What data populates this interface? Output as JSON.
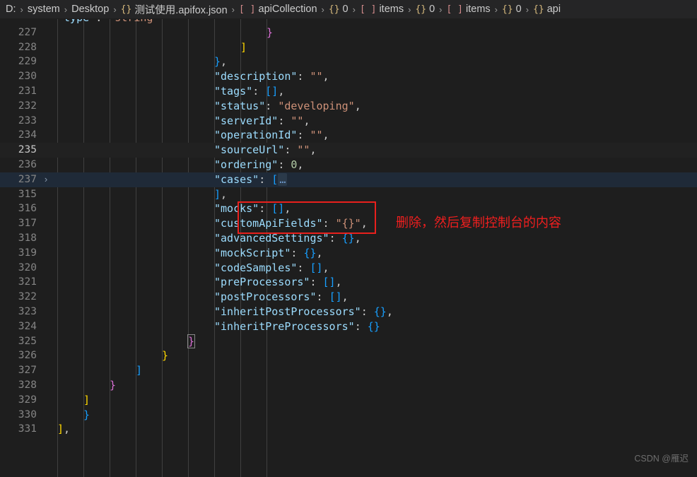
{
  "breadcrumb": {
    "name": "file-path-breadcrumb",
    "separator": "›",
    "items": [
      {
        "label": "D:",
        "symbol": "",
        "symbol_kind": "none"
      },
      {
        "label": "system",
        "symbol": "",
        "symbol_kind": "none"
      },
      {
        "label": "Desktop",
        "symbol": "",
        "symbol_kind": "none"
      },
      {
        "label": "测试使用.apifox.json",
        "symbol": "{}",
        "symbol_kind": "object"
      },
      {
        "label": "apiCollection",
        "symbol": "[ ]",
        "symbol_kind": "array"
      },
      {
        "label": "0",
        "symbol": "{}",
        "symbol_kind": "object"
      },
      {
        "label": "items",
        "symbol": "[ ]",
        "symbol_kind": "array"
      },
      {
        "label": "0",
        "symbol": "{}",
        "symbol_kind": "object"
      },
      {
        "label": "items",
        "symbol": "[ ]",
        "symbol_kind": "array"
      },
      {
        "label": "0",
        "symbol": "{}",
        "symbol_kind": "object"
      },
      {
        "label": "api",
        "symbol": "{}",
        "symbol_kind": "object"
      }
    ]
  },
  "editor": {
    "language": "json",
    "current_line": 235,
    "selected_line": 237,
    "folded_at_line": 237,
    "fold_chevron": "›",
    "lines": [
      {
        "num": "",
        "indent": 0,
        "state": "clipped-top",
        "tokens": [
          {
            "t": "\"type\"",
            "c": "k"
          },
          {
            "t": ": ",
            "c": "p"
          },
          {
            "t": "\"string\"",
            "c": "s"
          }
        ]
      },
      {
        "num": "227",
        "indent": 8,
        "state": "normal",
        "tokens": [
          {
            "t": "}",
            "c": "b2"
          }
        ]
      },
      {
        "num": "228",
        "indent": 7,
        "state": "normal",
        "tokens": [
          {
            "t": "]",
            "c": "b1"
          }
        ]
      },
      {
        "num": "229",
        "indent": 6,
        "state": "normal",
        "tokens": [
          {
            "t": "}",
            "c": "b3"
          },
          {
            "t": ",",
            "c": "p"
          }
        ]
      },
      {
        "num": "230",
        "indent": 6,
        "state": "normal",
        "tokens": [
          {
            "t": "\"description\"",
            "c": "k"
          },
          {
            "t": ": ",
            "c": "p"
          },
          {
            "t": "\"\"",
            "c": "s"
          },
          {
            "t": ",",
            "c": "p"
          }
        ]
      },
      {
        "num": "231",
        "indent": 6,
        "state": "normal",
        "tokens": [
          {
            "t": "\"tags\"",
            "c": "k"
          },
          {
            "t": ": ",
            "c": "p"
          },
          {
            "t": "[]",
            "c": "b3"
          },
          {
            "t": ",",
            "c": "p"
          }
        ]
      },
      {
        "num": "232",
        "indent": 6,
        "state": "normal",
        "tokens": [
          {
            "t": "\"status\"",
            "c": "k"
          },
          {
            "t": ": ",
            "c": "p"
          },
          {
            "t": "\"developing\"",
            "c": "s"
          },
          {
            "t": ",",
            "c": "p"
          }
        ]
      },
      {
        "num": "233",
        "indent": 6,
        "state": "normal",
        "tokens": [
          {
            "t": "\"serverId\"",
            "c": "k"
          },
          {
            "t": ": ",
            "c": "p"
          },
          {
            "t": "\"\"",
            "c": "s"
          },
          {
            "t": ",",
            "c": "p"
          }
        ]
      },
      {
        "num": "234",
        "indent": 6,
        "state": "normal",
        "tokens": [
          {
            "t": "\"operationId\"",
            "c": "k"
          },
          {
            "t": ": ",
            "c": "p"
          },
          {
            "t": "\"\"",
            "c": "s"
          },
          {
            "t": ",",
            "c": "p"
          }
        ]
      },
      {
        "num": "235",
        "indent": 6,
        "state": "current",
        "tokens": [
          {
            "t": "\"sourceUrl\"",
            "c": "k"
          },
          {
            "t": ": ",
            "c": "p"
          },
          {
            "t": "\"\"",
            "c": "s"
          },
          {
            "t": ",",
            "c": "p"
          }
        ]
      },
      {
        "num": "236",
        "indent": 6,
        "state": "normal",
        "tokens": [
          {
            "t": "\"ordering\"",
            "c": "k"
          },
          {
            "t": ": ",
            "c": "p"
          },
          {
            "t": "0",
            "c": "n"
          },
          {
            "t": ",",
            "c": "p"
          }
        ]
      },
      {
        "num": "237",
        "indent": 6,
        "state": "selected",
        "fold": true,
        "tokens": [
          {
            "t": "\"cases\"",
            "c": "k"
          },
          {
            "t": ": ",
            "c": "p"
          },
          {
            "t": "[",
            "c": "b3"
          },
          {
            "t": "…",
            "c": "fd"
          }
        ]
      },
      {
        "num": "315",
        "indent": 6,
        "state": "normal",
        "tokens": [
          {
            "t": "]",
            "c": "b3"
          },
          {
            "t": ",",
            "c": "p"
          }
        ]
      },
      {
        "num": "316",
        "indent": 6,
        "state": "normal",
        "tokens": [
          {
            "t": "\"mocks\"",
            "c": "k"
          },
          {
            "t": ": ",
            "c": "p"
          },
          {
            "t": "[]",
            "c": "b3"
          },
          {
            "t": ",",
            "c": "p"
          }
        ]
      },
      {
        "num": "317",
        "indent": 6,
        "state": "normal",
        "tokens": [
          {
            "t": "\"customApiFields\"",
            "c": "k"
          },
          {
            "t": ": ",
            "c": "p"
          },
          {
            "t": "\"{}\"",
            "c": "s"
          },
          {
            "t": ",",
            "c": "p"
          }
        ]
      },
      {
        "num": "318",
        "indent": 6,
        "state": "normal",
        "tokens": [
          {
            "t": "\"advancedSettings\"",
            "c": "k"
          },
          {
            "t": ": ",
            "c": "p"
          },
          {
            "t": "{}",
            "c": "b3"
          },
          {
            "t": ",",
            "c": "p"
          }
        ]
      },
      {
        "num": "319",
        "indent": 6,
        "state": "normal",
        "tokens": [
          {
            "t": "\"mockScript\"",
            "c": "k"
          },
          {
            "t": ": ",
            "c": "p"
          },
          {
            "t": "{}",
            "c": "b3"
          },
          {
            "t": ",",
            "c": "p"
          }
        ]
      },
      {
        "num": "320",
        "indent": 6,
        "state": "normal",
        "tokens": [
          {
            "t": "\"codeSamples\"",
            "c": "k"
          },
          {
            "t": ": ",
            "c": "p"
          },
          {
            "t": "[]",
            "c": "b3"
          },
          {
            "t": ",",
            "c": "p"
          }
        ]
      },
      {
        "num": "321",
        "indent": 6,
        "state": "normal",
        "tokens": [
          {
            "t": "\"preProcessors\"",
            "c": "k"
          },
          {
            "t": ": ",
            "c": "p"
          },
          {
            "t": "[]",
            "c": "b3"
          },
          {
            "t": ",",
            "c": "p"
          }
        ]
      },
      {
        "num": "322",
        "indent": 6,
        "state": "normal",
        "tokens": [
          {
            "t": "\"postProcessors\"",
            "c": "k"
          },
          {
            "t": ": ",
            "c": "p"
          },
          {
            "t": "[]",
            "c": "b3"
          },
          {
            "t": ",",
            "c": "p"
          }
        ]
      },
      {
        "num": "323",
        "indent": 6,
        "state": "normal",
        "tokens": [
          {
            "t": "\"inheritPostProcessors\"",
            "c": "k"
          },
          {
            "t": ": ",
            "c": "p"
          },
          {
            "t": "{}",
            "c": "b3"
          },
          {
            "t": ",",
            "c": "p"
          }
        ]
      },
      {
        "num": "324",
        "indent": 6,
        "state": "normal",
        "tokens": [
          {
            "t": "\"inheritPreProcessors\"",
            "c": "k"
          },
          {
            "t": ": ",
            "c": "p"
          },
          {
            "t": "{}",
            "c": "b3"
          }
        ]
      },
      {
        "num": "325",
        "indent": 5,
        "state": "normal",
        "tokens": [
          {
            "t": "}",
            "c": "b2 mb"
          }
        ]
      },
      {
        "num": "326",
        "indent": 4,
        "state": "normal",
        "tokens": [
          {
            "t": "}",
            "c": "b1"
          }
        ]
      },
      {
        "num": "327",
        "indent": 3,
        "state": "normal",
        "tokens": [
          {
            "t": "]",
            "c": "b3"
          }
        ]
      },
      {
        "num": "328",
        "indent": 2,
        "state": "normal",
        "tokens": [
          {
            "t": "}",
            "c": "b2"
          }
        ]
      },
      {
        "num": "329",
        "indent": 1,
        "state": "normal",
        "tokens": [
          {
            "t": "]",
            "c": "b1"
          }
        ]
      },
      {
        "num": "330",
        "indent": 1,
        "state": "normal",
        "tokens": [
          {
            "t": "}",
            "c": "b3"
          }
        ]
      },
      {
        "num": "331",
        "indent": 0,
        "state": "normal",
        "tokens": [
          {
            "t": "]",
            "c": "b1"
          },
          {
            "t": ",",
            "c": "p"
          }
        ]
      }
    ]
  },
  "annotation": {
    "text": "删除，然后复制控制台的内容",
    "box_color": "#e8201d",
    "text_color": "#f01e1e"
  },
  "watermark": {
    "text": "CSDN @雁迟"
  },
  "theme": {
    "editor_background": "#1e1e1e",
    "breadcrumb_background": "#252526",
    "line_number_color": "#858585",
    "current_line_background": "#212121",
    "selected_line_background": "#1f2a38",
    "indent_guide_color": "#404040",
    "key_color": "#9cdcfe",
    "string_color": "#ce9178",
    "number_color": "#b5cea8",
    "bracket_yellow": "#ffd700",
    "bracket_magenta": "#da70d6",
    "bracket_blue": "#179fff"
  }
}
